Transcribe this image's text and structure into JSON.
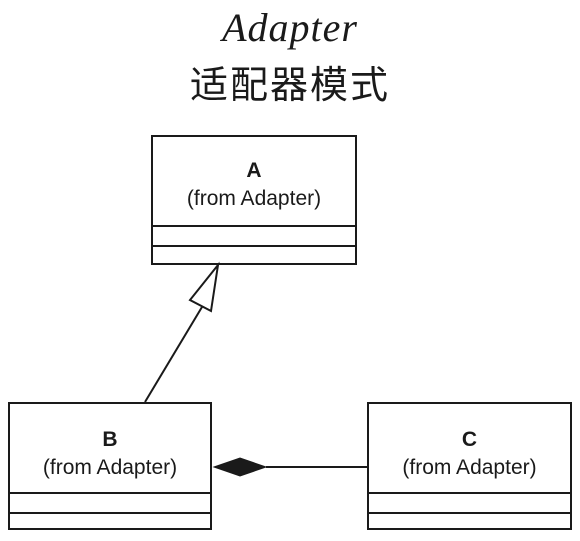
{
  "header": {
    "title": "Adapter",
    "subtitle": "适配器模式"
  },
  "classes": {
    "a": {
      "name": "A",
      "package": "(from Adapter)"
    },
    "b": {
      "name": "B",
      "package": "(from Adapter)"
    },
    "c": {
      "name": "C",
      "package": "(from Adapter)"
    }
  },
  "relations": [
    {
      "type": "generalization",
      "from": "B",
      "to": "A"
    },
    {
      "type": "composition",
      "whole": "B",
      "part": "C"
    }
  ]
}
